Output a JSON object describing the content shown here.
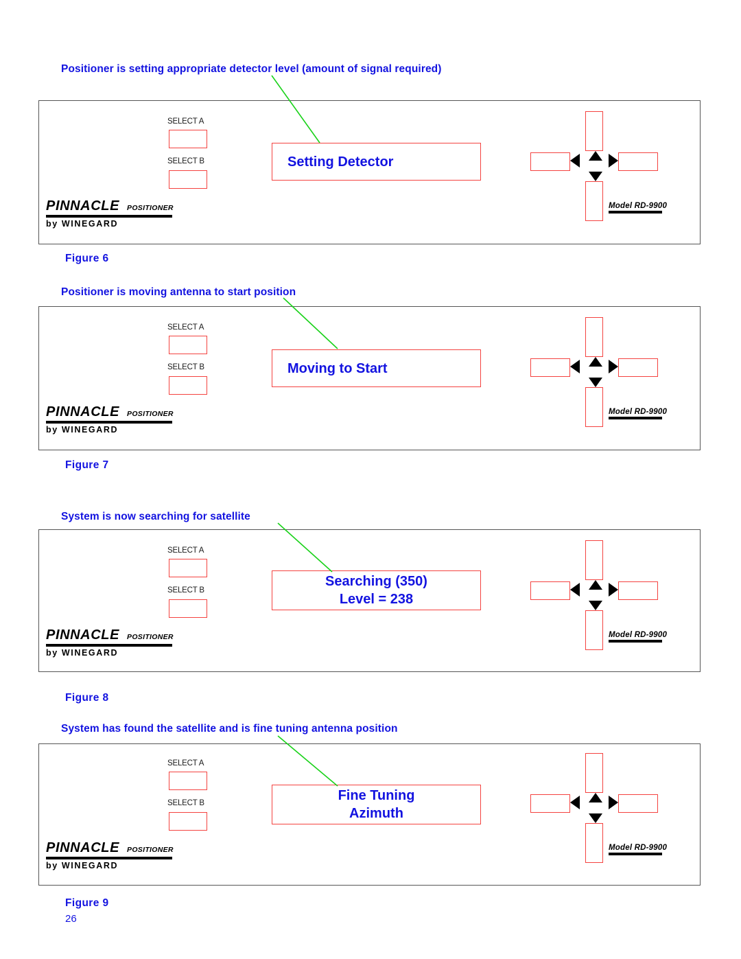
{
  "document": {
    "page_number": "26",
    "accent_blue": "#1313e0",
    "accent_red": "#f4423f",
    "leader_green": "#19d219",
    "panel_border": "#555555"
  },
  "common": {
    "select_a_label": "SELECT A",
    "select_b_label": "SELECT B",
    "brand_pinnacle": "PINNACLE",
    "brand_positioner": "POSITIONER",
    "brand_by_winegard": "by WINEGARD",
    "model_label": "Model RD-9900"
  },
  "sections": [
    {
      "caption": "Positioner is setting appropriate detector level (amount of signal required)",
      "display_lines": [
        "Setting Detector"
      ],
      "display_align": "left",
      "figure_label": "Figure 6"
    },
    {
      "caption": "Positioner is moving antenna to start position",
      "display_lines": [
        "Moving to Start"
      ],
      "display_align": "left",
      "figure_label": "Figure 7"
    },
    {
      "caption": "System is now searching for satellite",
      "display_lines": [
        "Searching (350)",
        "Level = 238"
      ],
      "display_align": "center",
      "figure_label": "Figure 8"
    },
    {
      "caption": "System has found the satellite and is fine tuning antenna position",
      "display_lines": [
        "Fine Tuning",
        "Azimuth"
      ],
      "display_align": "center",
      "figure_label": "Figure 9"
    }
  ]
}
